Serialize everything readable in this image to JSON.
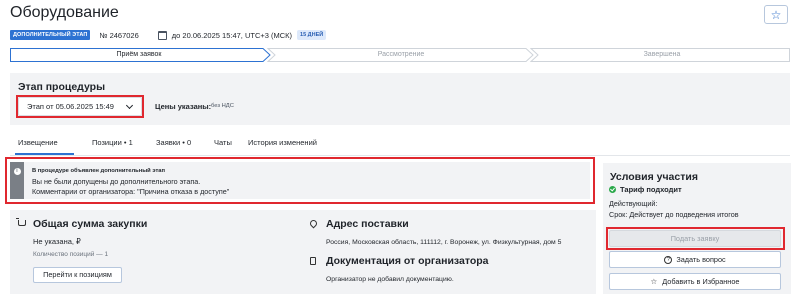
{
  "page": {
    "title": "Оборудование"
  },
  "meta": {
    "stage_badge": "ДОПОЛНИТЕЛЬНЫЙ ЭТАП",
    "procedure_number": "№ 2467026",
    "deadline": "до 20.06.2025 15:47, UTC+3 (МСК)",
    "days_badge": "15 ДНЕЙ"
  },
  "steps": [
    {
      "label": "Приём заявок",
      "state": "active"
    },
    {
      "label": "Рассмотрение",
      "state": "pending"
    },
    {
      "label": "Завершена",
      "state": "pending"
    }
  ],
  "stage": {
    "title": "Этап процедуры",
    "selected": "Этап от 05.06.2025 15:49",
    "price_label": "Цены указаны:",
    "price_value": "без НДС"
  },
  "tabs": [
    {
      "label": "Извещение",
      "active": true
    },
    {
      "label": "Позиции • 1",
      "active": false
    },
    {
      "label": "Заявки • 0",
      "active": false
    },
    {
      "label": "Чаты",
      "active": false
    },
    {
      "label": "История изменений",
      "active": false
    }
  ],
  "notice": {
    "title": "В процедуре объявлен дополнительный этап",
    "line1": "Вы не были допущены до дополнительного этапа.",
    "line2": "Комментарии от организатора: \"Причина отказа в доступе\""
  },
  "sum": {
    "title": "Общая сумма закупки",
    "value": "Не указана, ₽",
    "count": "Количество позиций — 1",
    "goto_button": "Перейти к позициям"
  },
  "delivery": {
    "title": "Адрес поставки",
    "address": "Россия, Московская область, 111112, г. Воронеж, ул. Физкультурная, дом 5"
  },
  "docs": {
    "title": "Документация от организатора",
    "text": "Организатор не добавил документацию."
  },
  "conditions": {
    "title": "Условия участия",
    "tariff": "Тариф подходит",
    "active_label": "Действующий:",
    "term": "Срок: Действует до подведения итогов",
    "apply_button": "Подать заявку",
    "ask_button": "Задать вопрос",
    "fav_button": "Добавить в Избранное"
  },
  "colors": {
    "accent": "#2d72d2",
    "highlight_red": "#e0282f",
    "panel_gray": "#f2f3f5",
    "success_green": "#2aa84a"
  },
  "icons": [
    "star-icon",
    "calendar-icon",
    "chevron-down-icon",
    "info-icon",
    "cart-icon",
    "location-pin-icon",
    "document-icon",
    "check-circle-icon",
    "question-circle-icon"
  ]
}
